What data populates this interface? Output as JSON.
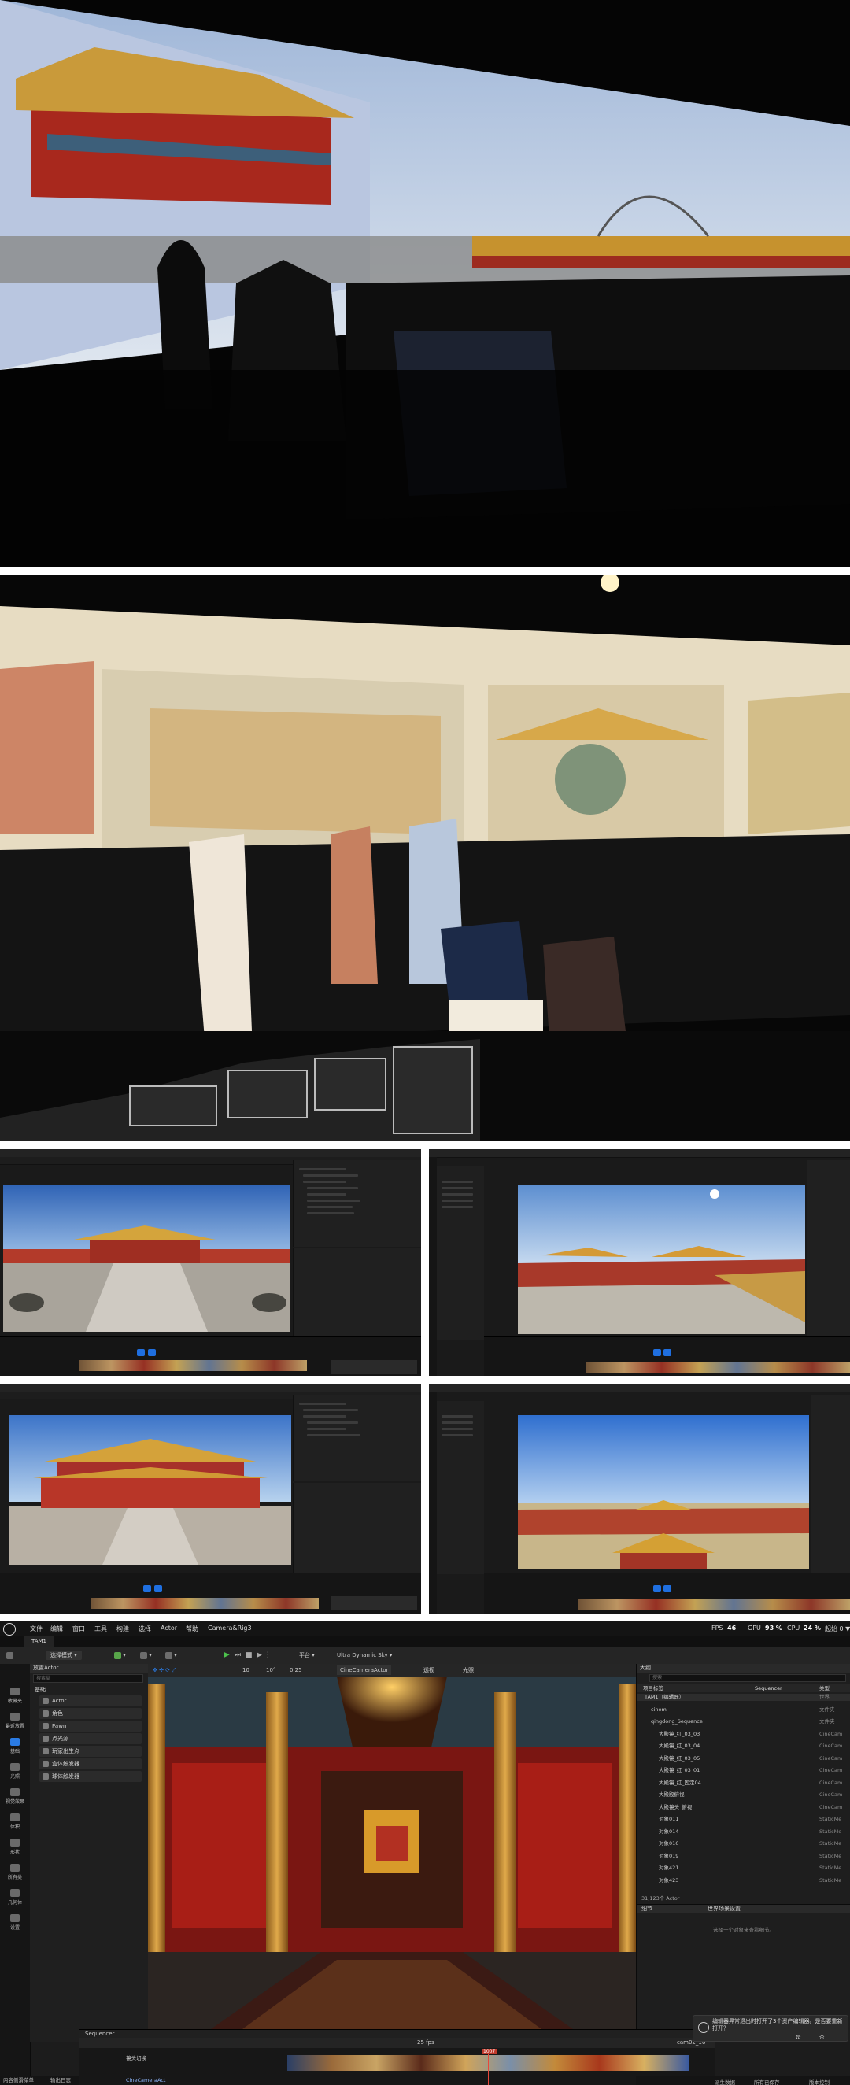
{
  "main_editor": {
    "menu": {
      "items": [
        "文件",
        "编辑",
        "窗口",
        "工具",
        "构建",
        "选择",
        "Actor",
        "帮助",
        "Camera&Rig3"
      ],
      "fps_label": "FPS",
      "fps_value": "46",
      "gpu_label": "GPU",
      "gpu_value": "93 %",
      "cpu_label": "CPU",
      "cpu_value": "24 %",
      "extra": "起始 0 ▼"
    },
    "level_tab": "TAM1",
    "toolbar": {
      "select_mode": "选择模式",
      "platform": "平台",
      "scalability": "Ultra Dynamic Sky",
      "camera": "CineCameraActor",
      "perspective": "透视",
      "lit": "光照",
      "grid": "10",
      "angle": "10°",
      "scale": "0.25"
    },
    "place_panel": {
      "title": "放置Actor",
      "search_placeholder": "搜索类",
      "section": "基础",
      "items": [
        "Actor",
        "角色",
        "Pawn",
        "点光源",
        "玩家出生点",
        "盒体触发器",
        "球体触发器"
      ]
    },
    "left_rail": [
      "收藏夹",
      "最近放置",
      "基础",
      "光照",
      "视觉效果",
      "体积",
      "形状",
      "所有类",
      "几何体",
      "设置"
    ],
    "outliner": {
      "title": "大纲",
      "search_placeholder": "搜索",
      "col_item": "项目标签",
      "col_type": "类型",
      "rows": [
        {
          "name": "TAM1（编辑器）",
          "type": "世界"
        },
        {
          "name": "cinem",
          "type": "文件夹"
        },
        {
          "name": "qingdong_Sequence",
          "type": "文件夹"
        },
        {
          "name": "大殿镜_红_03_03",
          "type": "CineCam"
        },
        {
          "name": "大殿镜_红_03_04",
          "type": "CineCam"
        },
        {
          "name": "大殿镜_红_03_05",
          "type": "CineCam"
        },
        {
          "name": "大殿镜_红_03_01",
          "type": "CineCam"
        },
        {
          "name": "大殿镜_红_固定04",
          "type": "CineCam"
        },
        {
          "name": "大殿殿俯视",
          "type": "CineCam"
        },
        {
          "name": "大殿镜头_俯视",
          "type": "CineCam"
        },
        {
          "name": "对象011",
          "type": "StaticMe"
        },
        {
          "name": "对象014",
          "type": "StaticMe"
        },
        {
          "name": "对象016",
          "type": "StaticMe"
        },
        {
          "name": "对象019",
          "type": "StaticMe"
        },
        {
          "name": "对象421",
          "type": "StaticMe"
        },
        {
          "name": "对象423",
          "type": "StaticMe"
        }
      ],
      "count": "31,123个 Actor"
    },
    "details": {
      "title": "细节",
      "tab2": "世界场景设置",
      "empty": "选择一个对象来查看细节。"
    },
    "sequencer": {
      "title": "Sequencer",
      "fps": "25 fps",
      "playhead": "1007",
      "camera_track": "CineCameraAct",
      "cut_track": "镜头切换",
      "seq_name": "cam02_16"
    },
    "toast": {
      "text": "编辑器异常退出时打开了3个资产编辑器。是否要重新打开？",
      "reopen": "是",
      "dismiss": "否"
    },
    "status": {
      "derived": "派生数据",
      "save": "所有已保存",
      "source": "版本控制"
    },
    "bottom_left": {
      "content": "内容侧滑菜单",
      "log": "输出日志",
      "cmd": "Cmd"
    }
  }
}
